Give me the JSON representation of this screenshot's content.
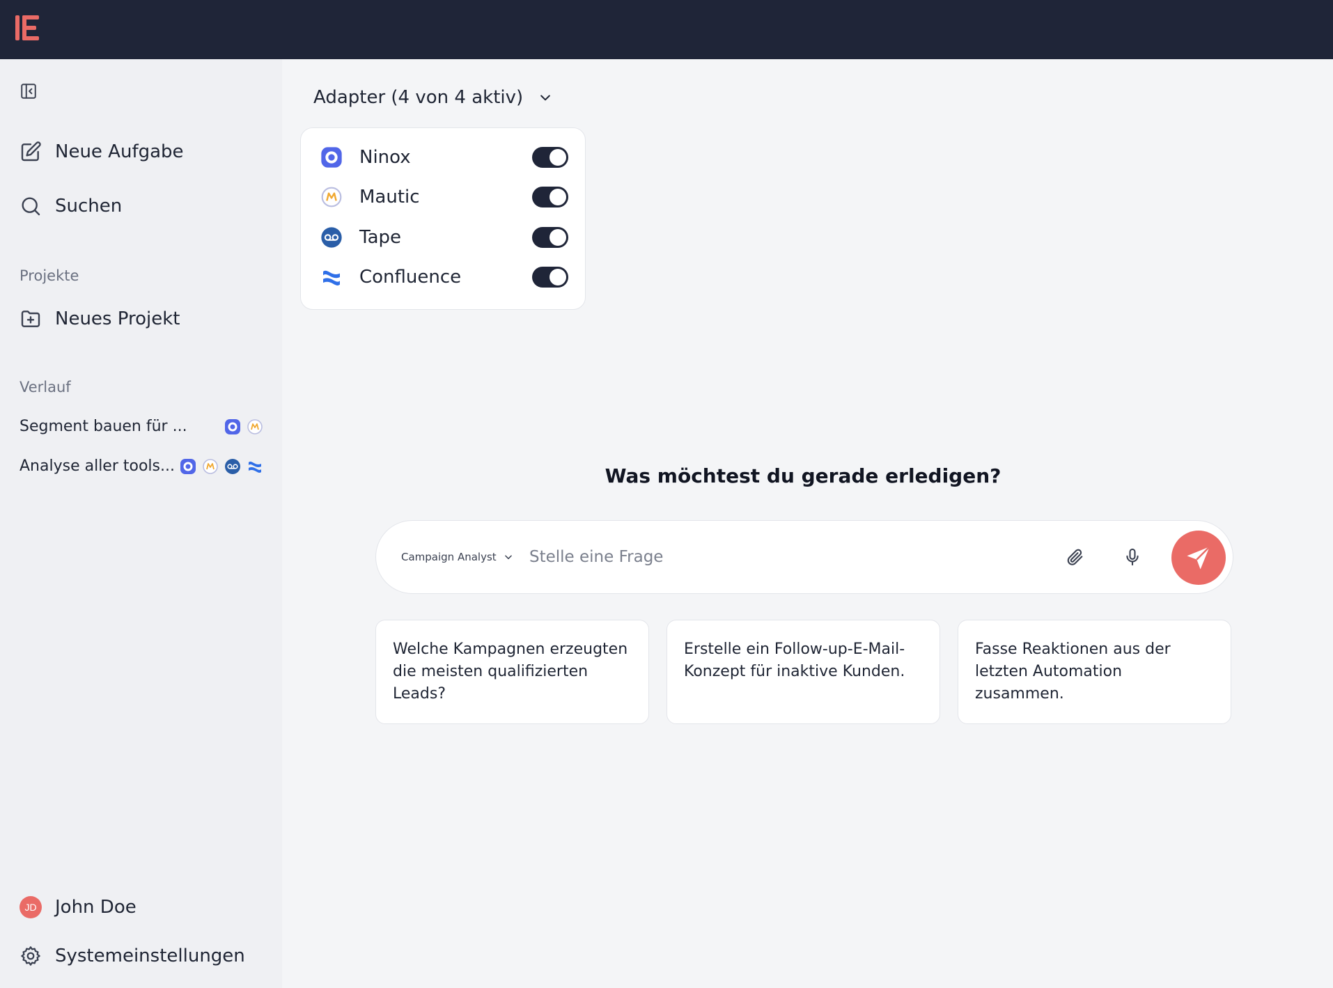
{
  "sidebar": {
    "new_task": "Neue Aufgabe",
    "search": "Suchen",
    "projects_label": "Projekte",
    "new_project": "Neues Projekt",
    "history_label": "Verlauf",
    "history": [
      {
        "title": "Segment bauen für ...",
        "adapters": [
          "ninox-icon",
          "mautic-icon"
        ]
      },
      {
        "title": "Analyse aller tools...",
        "adapters": [
          "ninox-icon",
          "mautic-icon",
          "tape-icon",
          "confluence-icon"
        ]
      }
    ],
    "user_initials": "JD",
    "user_name": "John Doe",
    "settings": "Systemeinstellungen"
  },
  "adapters": {
    "header": "Adapter (4 von 4 aktiv)",
    "items": [
      {
        "name": "Ninox",
        "icon": "ninox-icon",
        "enabled": true
      },
      {
        "name": "Mautic",
        "icon": "mautic-icon",
        "enabled": true
      },
      {
        "name": "Tape",
        "icon": "tape-icon",
        "enabled": true
      },
      {
        "name": "Confluence",
        "icon": "confluence-icon",
        "enabled": true
      }
    ]
  },
  "main": {
    "headline": "Was möchtest du gerade erledigen?",
    "agent": "Campaign Analyst",
    "prompt_placeholder": "Stelle eine Frage",
    "suggestions": [
      "Welche Kampagnen erzeugten die meisten qualifizierten Leads?",
      "Erstelle ein Follow-up-E-Mail-Konzept für inaktive Kunden.",
      "Fasse Reaktionen aus der letzten Automation zusammen."
    ]
  },
  "colors": {
    "topbar": "#1f2538",
    "accent": "#ea6b66",
    "toggle_on": "#1f2538"
  }
}
